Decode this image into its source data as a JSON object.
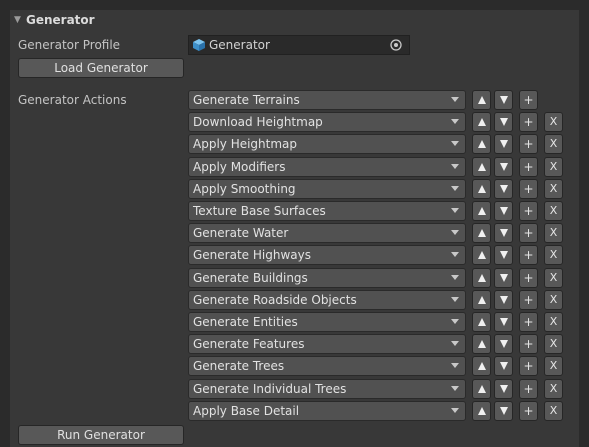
{
  "header": {
    "title": "Generator"
  },
  "profile": {
    "label": "Generator Profile",
    "value": "Generator",
    "icon": "prefab-cube-icon",
    "picker_icon": "object-picker-icon"
  },
  "load_button_label": "Load Generator",
  "actions_label": "Generator Actions",
  "actions": [
    {
      "label": "Generate Terrains",
      "removable": false
    },
    {
      "label": "Download Heightmap",
      "removable": true
    },
    {
      "label": "Apply Heightmap",
      "removable": true
    },
    {
      "label": "Apply Modifiers",
      "removable": true
    },
    {
      "label": "Apply Smoothing",
      "removable": true
    },
    {
      "label": "Texture Base Surfaces",
      "removable": true
    },
    {
      "label": "Generate Water",
      "removable": true
    },
    {
      "label": "Generate Highways",
      "removable": true
    },
    {
      "label": "Generate Buildings",
      "removable": true
    },
    {
      "label": "Generate Roadside Objects",
      "removable": true
    },
    {
      "label": "Generate Entities",
      "removable": true
    },
    {
      "label": "Generate Features",
      "removable": true
    },
    {
      "label": "Generate Trees",
      "removable": true
    },
    {
      "label": "Generate Individual Trees",
      "removable": true
    },
    {
      "label": "Apply Base Detail",
      "removable": true
    }
  ],
  "row_buttons": {
    "add": "+",
    "remove": "X"
  },
  "run_button_label": "Run Generator",
  "colors": {
    "background": "#383838",
    "button": "#585858",
    "dropdown": "#515151",
    "text": "#c4c4c4",
    "prefab_icon": "#4aa3df"
  }
}
